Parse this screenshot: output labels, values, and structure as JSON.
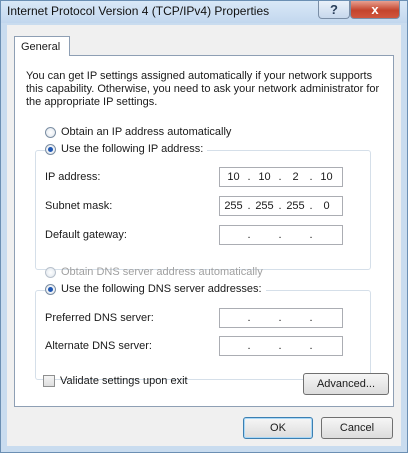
{
  "window": {
    "title": "Internet Protocol Version 4 (TCP/IPv4) Properties",
    "help_glyph": "?",
    "close_glyph": "x"
  },
  "tabs": [
    {
      "label": "General",
      "selected": true
    }
  ],
  "description": "You can get IP settings assigned automatically if your network supports this capability. Otherwise, you need to ask your network administrator for the appropriate IP settings.",
  "ip_section": {
    "obtain_auto_label": "Obtain an IP address automatically",
    "use_following_label": "Use the following IP address:",
    "selected": "use_following",
    "fields": [
      {
        "label": "IP address:",
        "octets": [
          "10",
          "10",
          "2",
          "10"
        ]
      },
      {
        "label": "Subnet mask:",
        "octets": [
          "255",
          "255",
          "255",
          "0"
        ]
      },
      {
        "label": "Default gateway:",
        "octets": [
          "",
          "",
          "",
          ""
        ]
      }
    ]
  },
  "dns_section": {
    "obtain_auto_label": "Obtain DNS server address automatically",
    "use_following_label": "Use the following DNS server addresses:",
    "selected": "use_following",
    "fields": [
      {
        "label": "Preferred DNS server:",
        "octets": [
          "",
          "",
          "",
          ""
        ]
      },
      {
        "label": "Alternate DNS server:",
        "octets": [
          "",
          "",
          "",
          ""
        ]
      }
    ]
  },
  "validate_label": "Validate settings upon exit",
  "validate_checked": false,
  "buttons": {
    "advanced": "Advanced...",
    "ok": "OK",
    "cancel": "Cancel"
  }
}
